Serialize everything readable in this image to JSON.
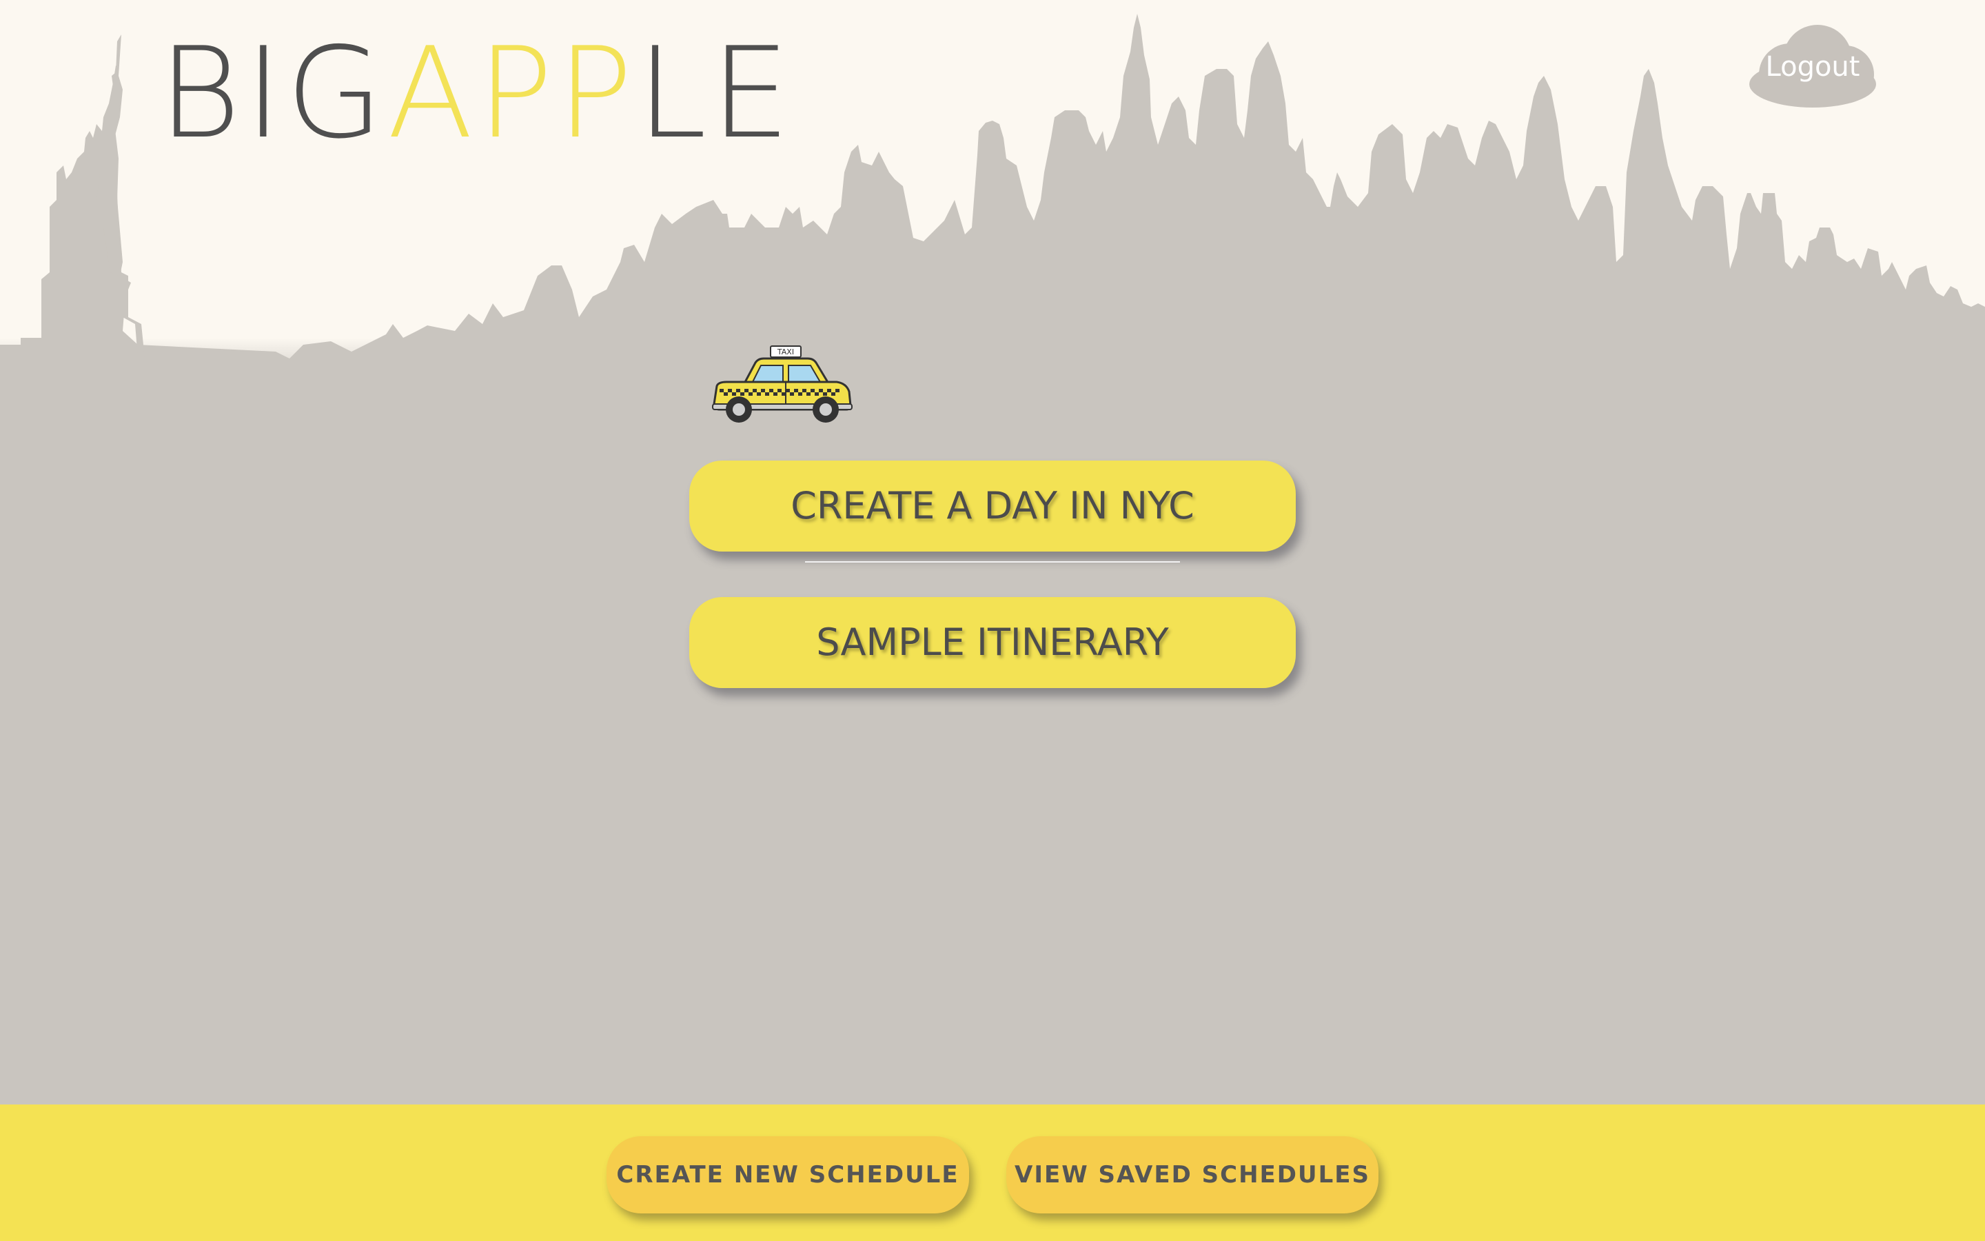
{
  "header": {
    "logo_part1": "BIG",
    "logo_part2": "APP",
    "logo_part3": "LE",
    "logout_label": "Logout"
  },
  "main": {
    "create_day_label": "CREATE A DAY IN NYC",
    "sample_itinerary_label": "SAMPLE ITINERARY",
    "taxi_sign": "TAXI"
  },
  "footer": {
    "create_schedule_label": "CREATE NEW SCHEDULE",
    "view_saved_label": "VIEW SAVED SCHEDULES"
  },
  "icons": {
    "logout": "cloud-icon",
    "taxi": "taxi-icon",
    "skyline": "nyc-skyline-illustration"
  },
  "colors": {
    "accent_yellow": "#f3e254",
    "footer_button": "#f6cd4c",
    "logo_dark": "#4f4f4f",
    "skyline": "#c9c5bf",
    "background_bottom": "#8b97ab"
  }
}
